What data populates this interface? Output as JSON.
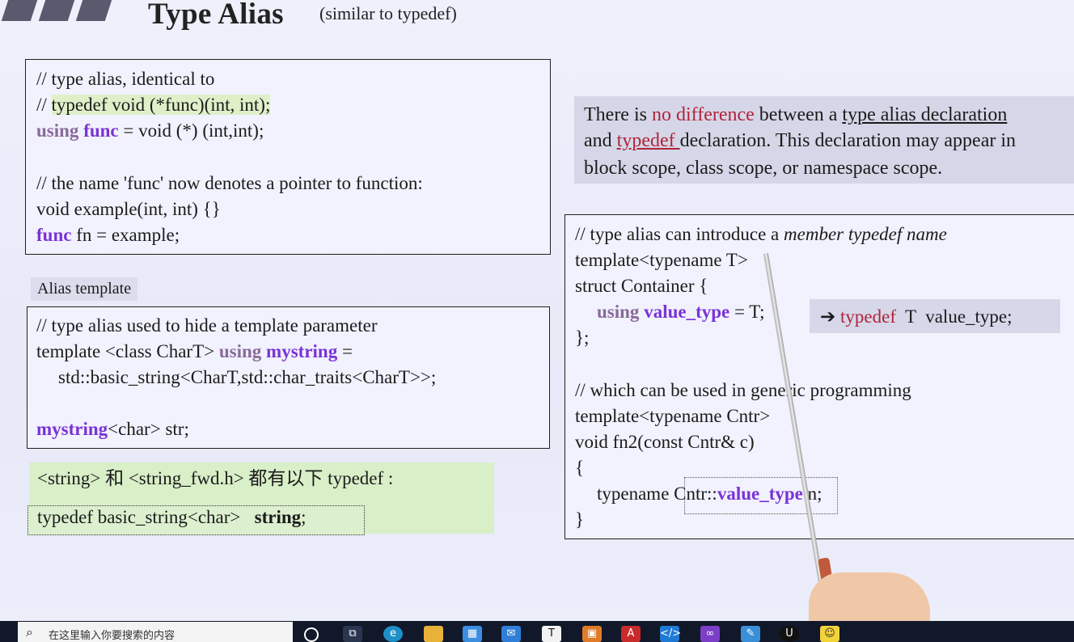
{
  "slide": {
    "title": "Type Alias",
    "subtitle": "(similar to typedef)"
  },
  "box1": {
    "l1": "// type alias, identical to",
    "l2a": "// ",
    "l2b": "typedef void (*func)(int, int);",
    "l3_using": "using",
    "l3_func": "func",
    "l3_rest": " = void (*) (int,int);",
    "l4": "// the name 'func' now denotes a pointer to function:",
    "l5": "void example(int, int) {}",
    "l6_func": "func",
    "l6_rest": " fn = example;"
  },
  "alias_label": "Alias template",
  "box2": {
    "l1": "// type alias used to hide a template parameter",
    "l2a": "template <class CharT> ",
    "l2_using": "using",
    "l2_mystring": "mystring",
    "l2_rest": " =",
    "l3": "std::basic_string<CharT,std::char_traits<CharT>>;",
    "l4_mystring": "mystring",
    "l4_rest": "<char> str;"
  },
  "green": {
    "l1": "<string> 和 <string_fwd.h> 都有以下 typedef :",
    "l2a": "typedef basic_string<char>   ",
    "l2b": "string",
    "l2c": ";"
  },
  "note": {
    "l1a": "There is ",
    "l1b": "no difference",
    "l1c": " between a ",
    "l1d": "type alias declaration",
    "l2a": "and ",
    "l2b": "typedef ",
    "l2c": "declaration. This declaration may appear in",
    "l3": "block scope, class scope, or namespace scope."
  },
  "box3": {
    "l1a": "// type alias can introduce a ",
    "l1b": "member typedef name",
    "l2": "template<typename T>",
    "l3": "struct Container {",
    "l4_using": "using",
    "l4_vt": "value_type",
    "l4_rest": " = T;",
    "l5": "};",
    "l6": "// which can be used in generic programming",
    "l7": "template<typename Cntr>",
    "l8": "void fn2(const Cntr& c)",
    "l9": "{",
    "l10a": "typename Cntr::",
    "l10b": "value_type",
    "l10c": " n;",
    "l11": "}"
  },
  "arrow_note": {
    "arrow": "➔",
    "typedef": "typedef",
    "rest": "  T  value_type;"
  },
  "taskbar": {
    "search_placeholder": "在这里输入你要搜索的内容",
    "search_icon": "search-icon"
  }
}
